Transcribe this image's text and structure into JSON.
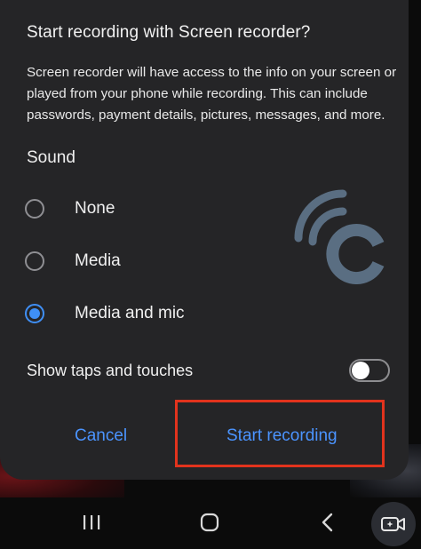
{
  "dialog": {
    "title": "Start recording with Screen recorder?",
    "description": "Screen recorder will have access to the info on your screen or played from your phone while recording. This can include passwords, payment details, pictures, messages, and more.",
    "sound_label": "Sound",
    "sound_options": [
      {
        "label": "None",
        "selected": false
      },
      {
        "label": "Media",
        "selected": false
      },
      {
        "label": "Media and mic",
        "selected": true
      }
    ],
    "show_taps_label": "Show taps and touches",
    "show_taps_enabled": false,
    "cancel_label": "Cancel",
    "start_label": "Start recording"
  },
  "watermark_icon": "wifi-c-logo",
  "navbar": {
    "icons": [
      "recents-icon",
      "home-icon",
      "back-icon",
      "screen-capture-icon"
    ]
  },
  "colors": {
    "dialog_bg": "#252527",
    "accent": "#3f8ff5",
    "button_text": "#4b94ff",
    "highlight_box": "#e2331d"
  }
}
